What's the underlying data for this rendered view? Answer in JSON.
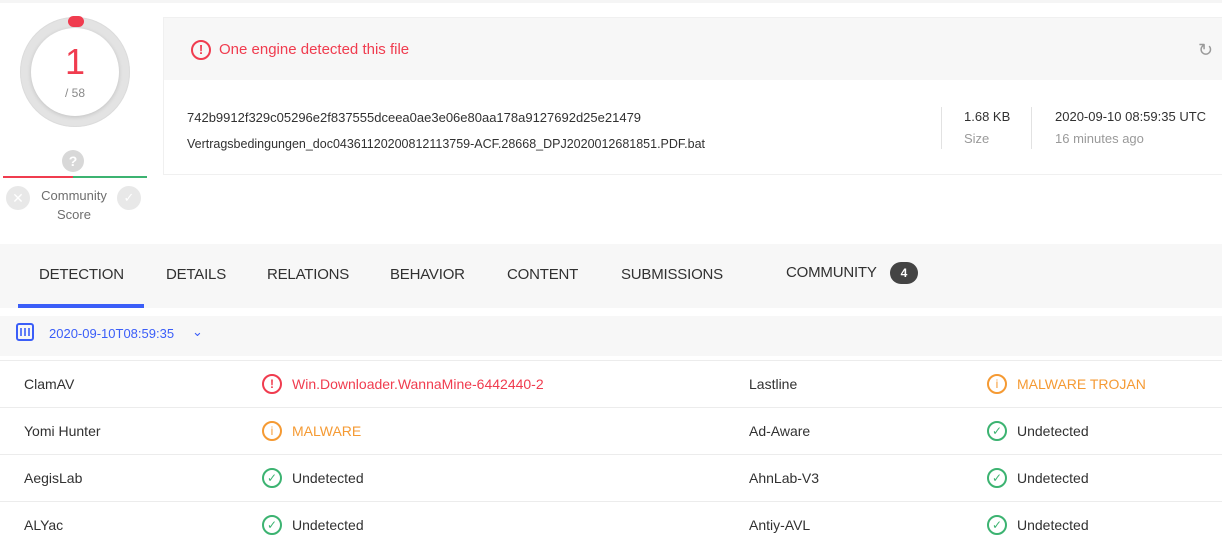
{
  "score": {
    "detections": "1",
    "total": "/ 58"
  },
  "community": {
    "label_line1": "Community",
    "label_line2": "Score",
    "unknown_icon": "?",
    "harmless_icon": "✓",
    "malicious_icon": "✕"
  },
  "alert": {
    "text": "One engine detected this file"
  },
  "file": {
    "hash": "742b9912f329c05296e2f837555dceea0ae3e06e80aa178a9127692d25e21479",
    "name": "Vertragsbedingungen_doc04361120200812113759-ACF.28668_DPJ2020012681851.PDF.bat",
    "size_value": "1.68 KB",
    "size_label": "Size",
    "date_value": "2020-09-10 08:59:35 UTC",
    "date_label": "16 minutes ago"
  },
  "tabs": [
    "DETECTION",
    "DETAILS",
    "RELATIONS",
    "BEHAVIOR",
    "CONTENT",
    "SUBMISSIONS",
    "COMMUNITY"
  ],
  "community_badge": "4",
  "analysis_date": "2020-09-10T08:59:35",
  "results": [
    {
      "left": {
        "engine": "ClamAV",
        "status": "malicious",
        "result": "Win.Downloader.WannaMine-6442440-2"
      },
      "right": {
        "engine": "Lastline",
        "status": "suspicious",
        "result": "MALWARE TROJAN"
      }
    },
    {
      "left": {
        "engine": "Yomi Hunter",
        "status": "suspicious",
        "result": "MALWARE"
      },
      "right": {
        "engine": "Ad-Aware",
        "status": "undetected",
        "result": "Undetected"
      }
    },
    {
      "left": {
        "engine": "AegisLab",
        "status": "undetected",
        "result": "Undetected"
      },
      "right": {
        "engine": "AhnLab-V3",
        "status": "undetected",
        "result": "Undetected"
      }
    },
    {
      "left": {
        "engine": "ALYac",
        "status": "undetected",
        "result": "Undetected"
      },
      "right": {
        "engine": "Antiy-AVL",
        "status": "undetected",
        "result": "Undetected"
      }
    }
  ],
  "colors": {
    "malicious": "#f03c4f",
    "suspicious": "#f59a33",
    "undetected": "#3cb371",
    "accent": "#3b5ef8"
  }
}
